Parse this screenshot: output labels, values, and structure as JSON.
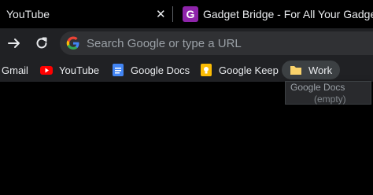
{
  "tabs": [
    {
      "title": "YouTube",
      "close": "✕"
    },
    {
      "title": "Gadget Bridge - For All Your Gadget Needs",
      "close": "✕",
      "favicon_letter": "G"
    }
  ],
  "toolbar": {
    "omnibox_placeholder": "Search Google or type a URL"
  },
  "bookmarks": [
    {
      "label": "Gmail"
    },
    {
      "label": "YouTube"
    },
    {
      "label": "Google Docs"
    },
    {
      "label": "Google Keep"
    },
    {
      "label": "Work"
    }
  ],
  "folder_menu": {
    "item": "Google Docs",
    "empty": "(empty)"
  },
  "colors": {
    "youtube_red": "#ff0000",
    "docs_blue": "#4285f4",
    "keep_yellow": "#fbbc04",
    "folder_yellow": "#f9d26b",
    "gadget_purple": "#8e24aa"
  }
}
